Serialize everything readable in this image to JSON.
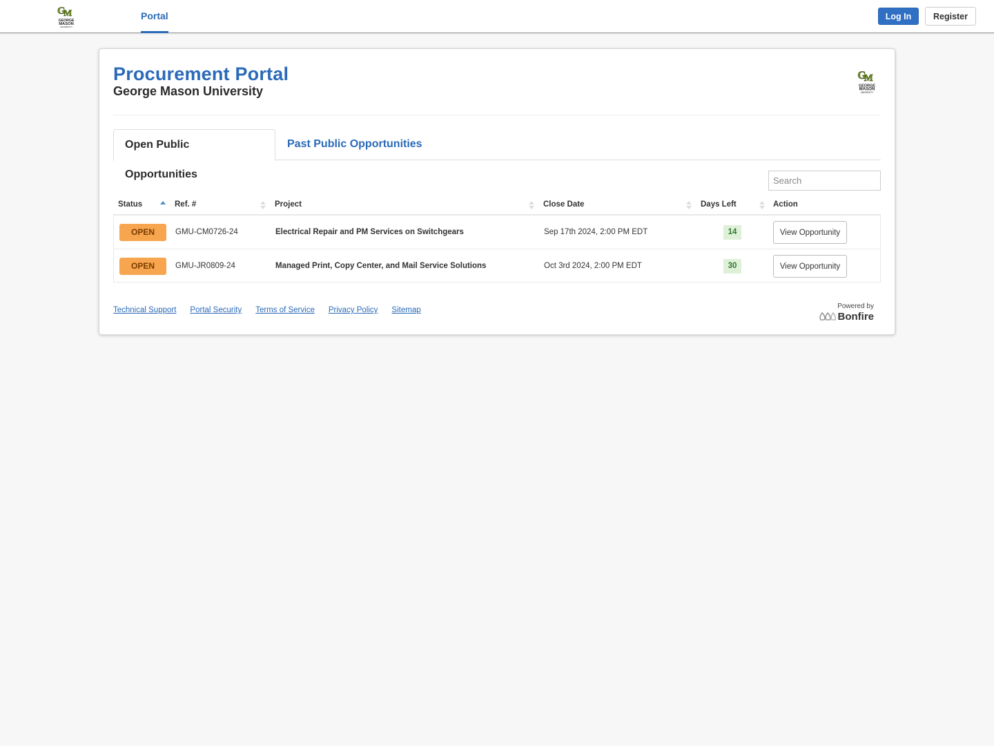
{
  "header": {
    "logo_alt": "George Mason University",
    "nav": [
      {
        "label": "Portal",
        "active": true
      }
    ],
    "login_label": "Log In",
    "register_label": "Register"
  },
  "page": {
    "title": "Procurement Portal",
    "subtitle": "George Mason University"
  },
  "tabs": [
    {
      "label": "Open Public Opportunities",
      "active": true
    },
    {
      "label": "Past Public Opportunities",
      "active": false
    }
  ],
  "search": {
    "placeholder": "Search",
    "value": ""
  },
  "table": {
    "columns": [
      {
        "label": "Status",
        "sort": "asc"
      },
      {
        "label": "Ref. #",
        "sort": "none"
      },
      {
        "label": "Project",
        "sort": "none"
      },
      {
        "label": "Close Date",
        "sort": "none"
      },
      {
        "label": "Days Left",
        "sort": "none"
      },
      {
        "label": "Action",
        "sort": null
      }
    ],
    "rows": [
      {
        "status": "OPEN",
        "ref": "GMU-CM0726-24",
        "project": "Electrical Repair and PM Services on Switchgears",
        "close_date": "Sep 17th 2024, 2:00 PM EDT",
        "days_left": "14",
        "action": "View Opportunity"
      },
      {
        "status": "OPEN",
        "ref": "GMU-JR0809-24",
        "project": "Managed Print, Copy Center, and Mail Service Solutions",
        "close_date": "Oct 3rd 2024, 2:00 PM EDT",
        "days_left": "30",
        "action": "View Opportunity"
      }
    ]
  },
  "footer": {
    "links": [
      "Technical Support",
      "Portal Security",
      "Terms of Service",
      "Privacy Policy",
      "Sitemap"
    ],
    "powered_by": "Powered by",
    "brand": "Bonfire"
  },
  "colors": {
    "accent": "#2a6ab8",
    "login_bg": "#2f6fc4",
    "open_badge": "#f7a54e",
    "days_badge": "#dff0d8",
    "gmu_green": "#6b8e23"
  }
}
